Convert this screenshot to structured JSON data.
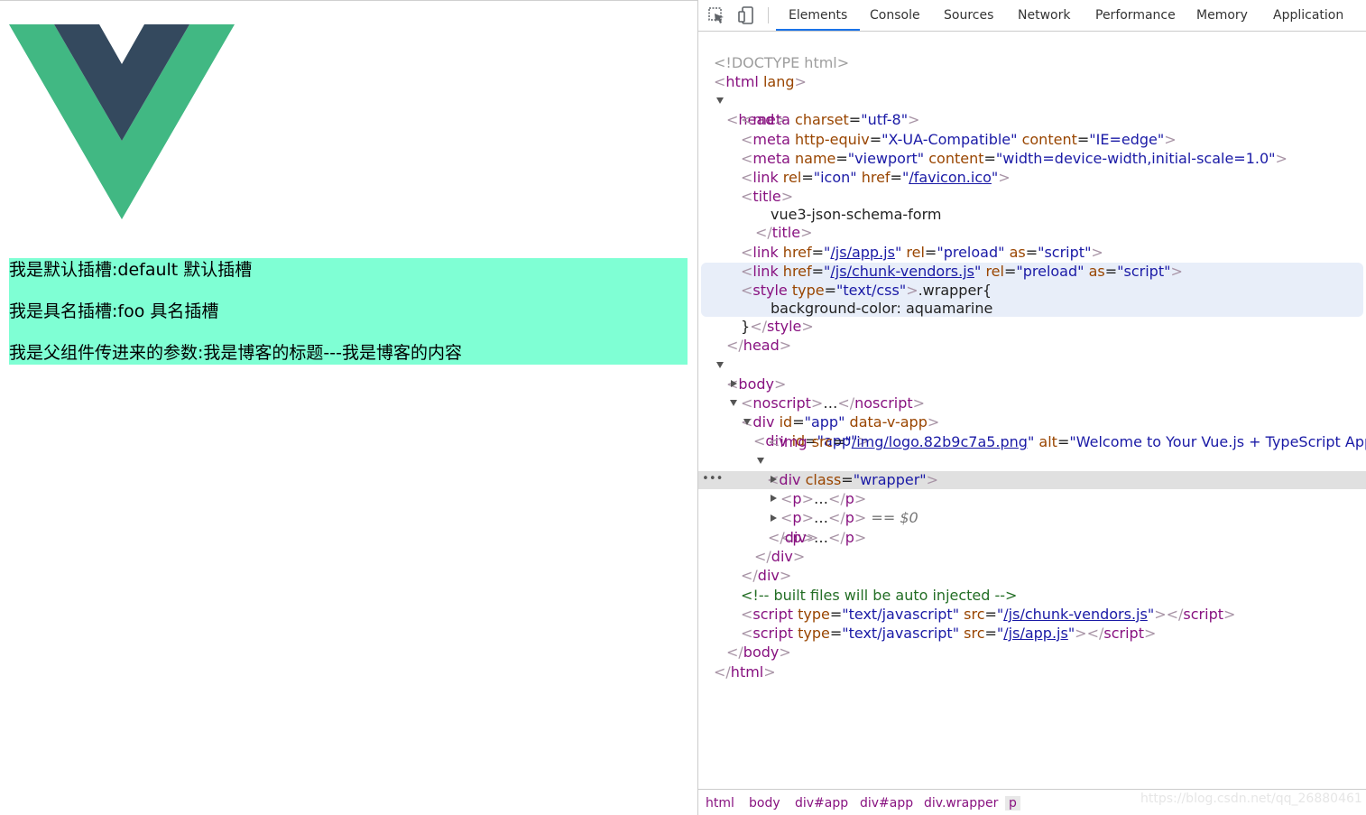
{
  "page": {
    "paragraphs": [
      "我是默认插槽:default 默认插槽",
      "我是具名插槽:foo 具名插槽",
      "我是父组件传进来的参数:我是博客的标题---我是博客的内容"
    ],
    "colors": {
      "wrapper_bg": "#7fffd4",
      "vue_green": "#41b883",
      "vue_dark": "#34495e"
    }
  },
  "devtools": {
    "tabs": [
      "Elements",
      "Console",
      "Sources",
      "Network",
      "Performance",
      "Memory",
      "Application"
    ],
    "active_tab": "Elements",
    "tree": {
      "doctype": "<!DOCTYPE html>",
      "html_open": "html",
      "html_lang": "lang",
      "head": "head",
      "meta1": {
        "tag": "meta",
        "attr": "charset",
        "val": "utf-8"
      },
      "meta2": {
        "tag": "meta",
        "attr1": "http-equiv",
        "val1": "X-UA-Compatible",
        "attr2": "content",
        "val2": "IE=edge"
      },
      "meta3": {
        "tag": "meta",
        "attr1": "name",
        "val1": "viewport",
        "attr2": "content",
        "val2": "width=device-width,initial-scale=1.0"
      },
      "link_icon": {
        "tag": "link",
        "attr1": "rel",
        "val1": "icon",
        "attr2": "href",
        "val2": "/favicon.ico"
      },
      "title_tag": "title",
      "title_text": "vue3-json-schema-form",
      "link_app": {
        "tag": "link",
        "attr1": "href",
        "val1": "/js/app.js",
        "attr2": "rel",
        "val2": "preload",
        "attr3": "as",
        "val3": "script"
      },
      "link_vendors": {
        "tag": "link",
        "attr1": "href",
        "val1": "/js/chunk-vendors.js",
        "attr2": "rel",
        "val2": "preload",
        "attr3": "as",
        "val3": "script"
      },
      "style": {
        "tag": "style",
        "attr": "type",
        "val": "text/css",
        "css1": ".wrapper{",
        "css2": "background-color: aquamarine",
        "css3": "}"
      },
      "body": "body",
      "noscript": "noscript",
      "div_app1": {
        "tag": "div",
        "attr1": "id",
        "val1": "app",
        "attr2": "data-v-app"
      },
      "div_app2": {
        "tag": "div",
        "attr": "id",
        "val": "app"
      },
      "img": {
        "tag": "img",
        "attr1": "src",
        "val1": "/img/logo.82b9c7a5.png",
        "attr2": "alt",
        "val2": "Welcome to Your Vue.js + TypeScript App"
      },
      "div_wrapper": {
        "tag": "div",
        "attr": "class",
        "val": "wrapper"
      },
      "p_tag": "p",
      "ellipsis": "…",
      "selected_marker": "== $0",
      "div_tag": "div",
      "comment": "<!-- built files will be auto injected -->",
      "script1": {
        "tag": "script",
        "attr1": "type",
        "val1": "text/javascript",
        "attr2": "src",
        "val2": "/js/chunk-vendors.js"
      },
      "script2": {
        "tag": "script",
        "attr1": "type",
        "val1": "text/javascript",
        "attr2": "src",
        "val2": "/js/app.js"
      },
      "dots": "•••"
    },
    "breadcrumbs": [
      "html",
      "body",
      "div#app",
      "div#app",
      "div.wrapper",
      "p"
    ],
    "watermark": "https://blog.csdn.net/qq_26880461"
  }
}
